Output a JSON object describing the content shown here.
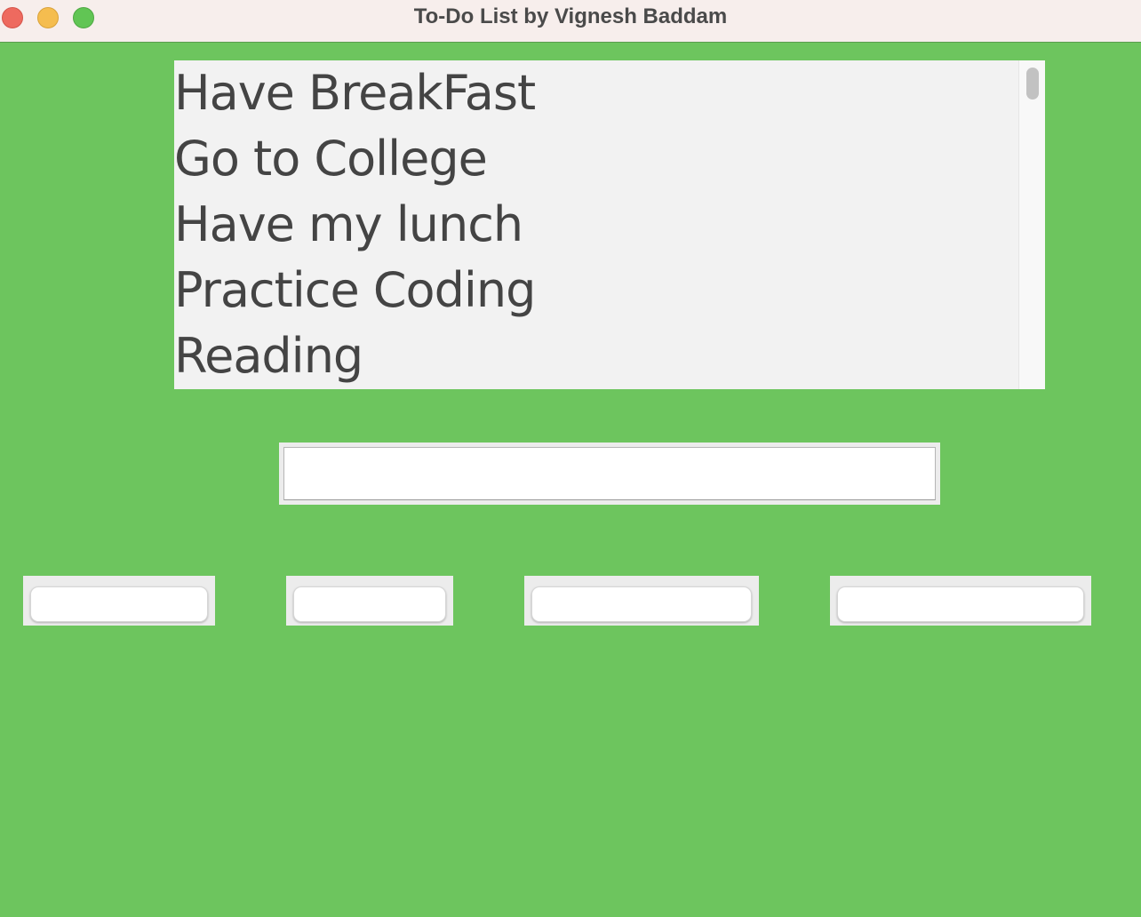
{
  "window": {
    "title": "To-Do List by Vignesh Baddam",
    "controls": [
      "close",
      "minimize",
      "maximize"
    ]
  },
  "tasks": {
    "items": [
      "Have BreakFast",
      "Go to College",
      "Have my lunch",
      "Practice Coding",
      "Reading"
    ]
  },
  "entry": {
    "value": ""
  },
  "buttons": {
    "labels": [
      "",
      "",
      "",
      ""
    ]
  },
  "colors": {
    "background": "#6dc55e",
    "titlebar": "#f7eeec",
    "listbox": "#f2f2f2",
    "text": "#444444",
    "close": "#ee6a5f",
    "minimize": "#f5bd4f",
    "maximize": "#61c554"
  }
}
